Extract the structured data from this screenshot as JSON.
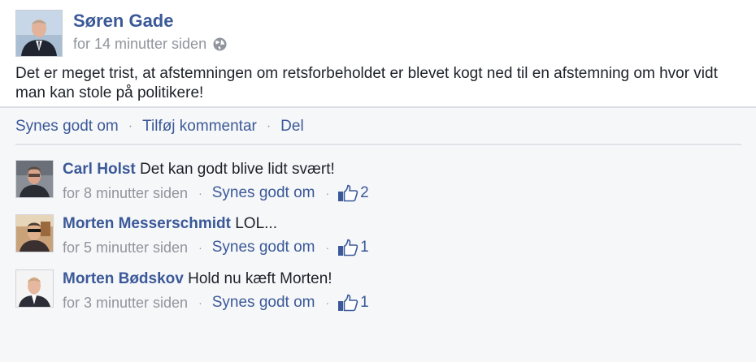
{
  "post": {
    "author": "Søren Gade",
    "timestamp": "for 14 minutter siden",
    "privacy_icon": "globe-icon",
    "text": "Det er meget trist, at afstemningen om retsforbeholdet er blevet kogt ned til en afstemning om hvor vidt man kan stole på politikere!"
  },
  "actions": {
    "like": "Synes godt om",
    "comment": "Tilføj kommentar",
    "share": "Del",
    "separator": "·"
  },
  "comments": [
    {
      "author": "Carl Holst",
      "text": "Det kan godt blive lidt svært!",
      "timestamp": "for 8 minutter siden",
      "like_label": "Synes godt om",
      "like_count": "2"
    },
    {
      "author": "Morten Messerschmidt",
      "text": "LOL...",
      "timestamp": "for 5 minutter siden",
      "like_label": "Synes godt om",
      "like_count": "1"
    },
    {
      "author": "Morten Bødskov",
      "text": "Hold nu kæft Morten!",
      "timestamp": "for 3 minutter siden",
      "like_label": "Synes godt om",
      "like_count": "1"
    }
  ],
  "colors": {
    "link": "#3b5998",
    "meta": "#90949c",
    "text": "#1d2129",
    "feedback_bg": "#f6f7f9"
  }
}
